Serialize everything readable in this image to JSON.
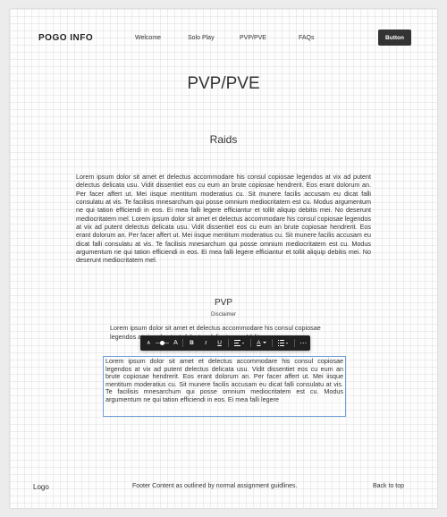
{
  "header": {
    "logo": "POGO INFO",
    "nav": [
      "Welcome",
      "Solo Play",
      "PVP/PVE",
      "FAQs"
    ],
    "button_label": "Button"
  },
  "main": {
    "title": "PVP/PVE",
    "section_heading": "Raids",
    "paragraph": "Lorem ipsum dolor sit amet et delectus accommodare his consul copiosae legendos at vix ad putent delectus delicata usu. Vidit dissentiet eos cu eum an brute copiosae hendrerit. Eos erant dolorum an. Per facer affert ut. Mei iisque mentitum moderatius cu. Sit munere facilis accusam eu dicat falli consulatu at vis. Te facilisis mnesarchum qui posse omnium mediocritatem est cu. Modus argumentum ne qui tation efficiendi in eos. Ei mea falli legere efficiantur et tollit aliquip debitis mei. No deserunt mediocritatem mel. Lorem ipsum dolor sit amet et delectus accommodare his consul copiosae legendos at vix ad putent delectus delicata usu. Vidit dissentiet eos cu eum an brute copiosae hendrerit. Eos erant dolorum an. Per facer affert ut. Mei iisque mentitum moderatius cu. Sit munere facilis accusam eu dicat falli consulatu at vis. Te facilisis mnesarchum qui posse omnium mediocritatem est cu. Modus argumentum ne qui tation efficiendi in eos. Ei mea falli legere efficiantur et tollit aliquip debitis mei. No deserunt mediocritatem mel.",
    "subheading": "PVP",
    "disclaimer": "Disclaimer",
    "paragraph2": "Lorem ipsum dolor sit amet et delectus accommodare his consul copiosae legendos at vix ad putent delectus delicata usu. Vidit",
    "editor_text": "Lorem ipsum dolor sit amet et delectus accommodare his consul copiosae legendos at vix ad putent delectus delicata usu. Vidit dissentiet eos cu eum an brute copiosae hendrerit. Eos erant dolorum an. Per facer affert ut. Mei iisque mentitum moderatius cu. Sit munere facilis accusam eu dicat falli consulatu at vis. Te facilisis mnesarchum qui posse omnium mediocritatem est cu. Modus argumentum ne qui tation efficiendi in eos. Ei mea falli legere"
  },
  "toolbar": {
    "font_size_small": "A",
    "font_size_large": "A",
    "bold": "B",
    "italic": "I",
    "underline": "U",
    "text_color": "A",
    "more": "⋯",
    "font_size_level": 0.5,
    "text_color_hex": "#ffffff"
  },
  "footer": {
    "logo": "Logo",
    "content": "Footer Content as outlined by normal assignment guidlines.",
    "back_to_top": "Back to top"
  }
}
